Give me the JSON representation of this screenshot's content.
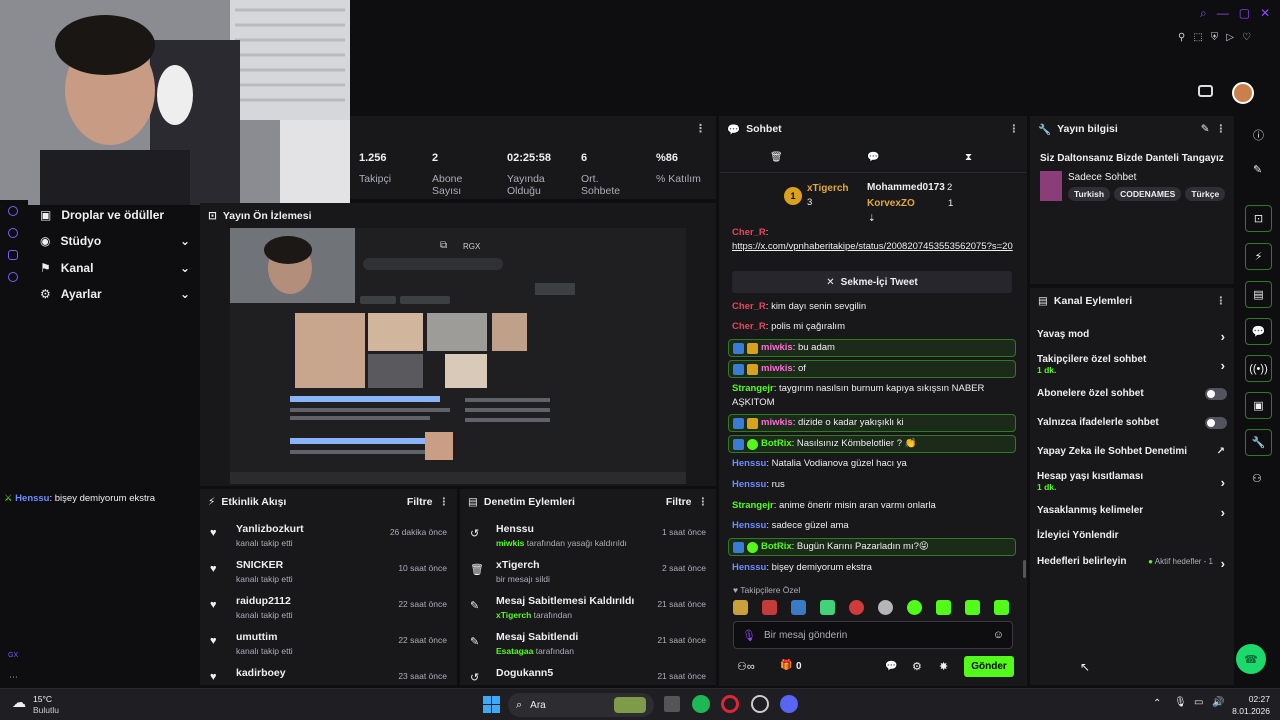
{
  "stats": [
    {
      "value": "1.256",
      "label": "Takipçi"
    },
    {
      "value": "2",
      "label": "Abone Sayısı"
    },
    {
      "value": "02:25:58",
      "label": "Yayında Olduğu"
    },
    {
      "value": "6",
      "label": "Ort. Sohbete"
    },
    {
      "value": "%86",
      "label": "% Katılım"
    }
  ],
  "nav": [
    {
      "label": "Droplar ve ödüller"
    },
    {
      "label": "Stüdyo"
    },
    {
      "label": "Kanal"
    },
    {
      "label": "Ayarlar"
    }
  ],
  "left_chat_line": {
    "user": "Henssu",
    "text": ": bişey demiyorum ekstra"
  },
  "left_badge": "GX",
  "preview": {
    "title": "Yayın Ön İzlemesi",
    "tag": "RGX"
  },
  "activity": {
    "title": "Etkinlik Akışı",
    "filter": "Filtre",
    "items": [
      {
        "name": "Yanlizbozkurt",
        "sub": "kanalı takip etti",
        "time": "26 dakika önce"
      },
      {
        "name": "SNICKER",
        "sub": "kanalı takip etti",
        "time": "10 saat önce"
      },
      {
        "name": "raidup2112",
        "sub": "kanalı takip etti",
        "time": "22 saat önce"
      },
      {
        "name": "umuttim",
        "sub": "kanalı takip etti",
        "time": "22 saat önce"
      },
      {
        "name": "kadirboey",
        "sub": "",
        "time": "23 saat önce"
      }
    ]
  },
  "moderation": {
    "title": "Denetim Eylemleri",
    "filter": "Filtre",
    "items": [
      {
        "name": "Henssu",
        "actor": "miwkis",
        "sub": "tarafından yasağı kaldırıldı",
        "time": "1 saat önce"
      },
      {
        "name": "xTigerch",
        "actor": "",
        "sub": "bir mesajı sildi",
        "time": "2 saat önce"
      },
      {
        "name": "Mesaj Sabitlemesi Kaldırıldı",
        "actor": "xTigerch",
        "sub": "tarafından",
        "time": "21 saat önce"
      },
      {
        "name": "Mesaj Sabitlendi",
        "actor": "Esatagaa",
        "sub": "tarafından",
        "time": "21 saat önce"
      },
      {
        "name": "Dogukann5",
        "actor": "",
        "sub": "",
        "time": "21 saat önce"
      }
    ]
  },
  "chat": {
    "title": "Sohbet",
    "leaders": [
      {
        "rank": "1",
        "name": "xTigerch",
        "count": "3"
      },
      {
        "name": "Mohammed0173",
        "count": "2"
      },
      {
        "name": "KorvexZO",
        "count": "1"
      }
    ],
    "link_user": "Cher_R",
    "link_url": "https://x.com/vpnhaberitakipe/status/2008207453553562075?s=20",
    "tweet_button": "Sekme-İçi Tweet",
    "messages": [
      {
        "user": "Cher_R",
        "text": ": kim dayı senin sevgilin"
      },
      {
        "user": "Cher_R",
        "text": ": polis mi çağıralım"
      },
      {
        "user": "miwkis",
        "text": ": bu adam"
      },
      {
        "user": "miwkis",
        "text": ": of"
      },
      {
        "user": "Strangejr",
        "text": ": taygırım nasılsın burnum kapıya sıkışsın NABER AŞKITOM"
      },
      {
        "user": "miwkis",
        "text": ": dizide o kadar yakışıklı ki"
      },
      {
        "user": "BotRix",
        "text": ": Nasılsınız Kömbelotlier ? 👏"
      },
      {
        "user": "Henssu",
        "text": ": Natalia Vodianova güzel hacı ya"
      },
      {
        "user": "Henssu",
        "text": ": rus"
      },
      {
        "user": "Strangejr",
        "text": ": anime önerir misin aran varmı onlarla"
      },
      {
        "user": "Henssu",
        "text": ": sadece güzel ama"
      },
      {
        "user": "BotRix",
        "text": ": Bugün Karını Pazarladın mı?😝"
      },
      {
        "user": "Henssu",
        "text": ": bişey demiyorum ekstra"
      }
    ],
    "emote_label": "Takipçilere Özel",
    "input_placeholder": "Bir mesaj gönderin",
    "counter": "0",
    "send": "Gönder"
  },
  "stream_info": {
    "title": "Yayın bilgisi",
    "stream_title": "Siz Daltonsanız Bizde Danteli Tangayız",
    "category": "Sadece Sohbet",
    "tags": [
      "Turkish",
      "CODENAMES",
      "Türkçe"
    ]
  },
  "channel_actions": {
    "title": "Kanal Eylemleri",
    "items": [
      {
        "label": "Yavaş mod",
        "sub": "",
        "control": "arrow"
      },
      {
        "label": "Takipçilere özel sohbet",
        "sub": "1 dk.",
        "control": "arrow"
      },
      {
        "label": "Abonelere özel sohbet",
        "sub": "",
        "control": "toggle"
      },
      {
        "label": "Yalnızca ifadelerle sohbet",
        "sub": "",
        "control": "toggle"
      },
      {
        "label": "Yapay Zeka ile Sohbet Denetimi",
        "sub": "",
        "control": "external"
      },
      {
        "label": "Hesap yaşı kısıtlaması",
        "sub": "1 dk.",
        "control": "arrow"
      },
      {
        "label": "Yasaklanmış kelimeler",
        "sub": "",
        "control": "arrow"
      },
      {
        "label": "İzleyici Yönlendir",
        "sub": "",
        "control": "none"
      },
      {
        "label": "Hedefleri belirleyin",
        "sub": "",
        "control": "arrow",
        "extra": "Aktif hedefler - 1"
      }
    ]
  },
  "taskbar": {
    "temp": "15°C",
    "weather": "Bulutlu",
    "search": "Ara",
    "time": "02:27",
    "date": "8.01.2026"
  },
  "colors": {
    "accent": "#53fc18",
    "panel": "#18181b",
    "bg": "#0e0e10"
  }
}
